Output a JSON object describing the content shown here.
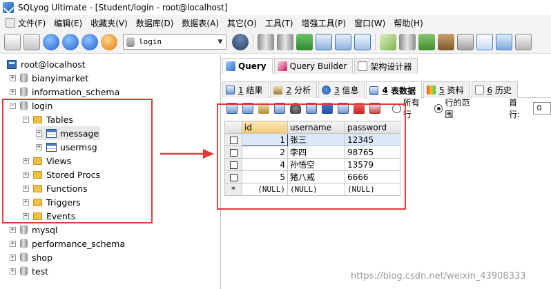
{
  "app": {
    "title": "SQLyog Ultimate - [Student/login - root@localhost]"
  },
  "menu": [
    "文件(F)",
    "编辑(E)",
    "收藏夹(V)",
    "数据库(D)",
    "数据表(A)",
    "其它(O)",
    "工具(T)",
    "增强工具(P)",
    "窗口(W)",
    "帮助(H)"
  ],
  "toolbar": {
    "db_selected": "login"
  },
  "tree": {
    "connection": "root@localhost",
    "databases": [
      "bianyimarket",
      "information_schema",
      "login",
      "mysql",
      "performance_schema",
      "shop",
      "test"
    ],
    "login_children": [
      "Tables",
      "Views",
      "Stored Procs",
      "Functions",
      "Triggers",
      "Events"
    ],
    "tables": [
      "message",
      "usermsg"
    ]
  },
  "top_tabs": [
    "Query",
    "Query Builder",
    "架构设计器"
  ],
  "bottom_tabs": [
    {
      "num": "1",
      "label": "结果"
    },
    {
      "num": "2",
      "label": "分析"
    },
    {
      "num": "3",
      "label": "信息"
    },
    {
      "num": "4",
      "label": "表数据"
    },
    {
      "num": "5",
      "label": "资料"
    },
    {
      "num": "6",
      "label": "历史"
    }
  ],
  "grid_options": {
    "all_rows": "所有行",
    "row_range": "行的范围",
    "first_row_label": "首行:",
    "first_row_value": "0"
  },
  "table": {
    "columns": [
      "id",
      "username",
      "password"
    ],
    "rows": [
      [
        "1",
        "张三",
        "12345"
      ],
      [
        "2",
        "李四",
        "98765"
      ],
      [
        "4",
        "孙悟空",
        "13579"
      ],
      [
        "5",
        "猪八戒",
        "6666"
      ],
      [
        "(NULL)",
        "(NULL)",
        "(NULL)"
      ]
    ],
    "new_row_marker": "*"
  },
  "watermark": "https://blog.csdn.net/weixin_43908333",
  "colors": {
    "annotation": "#e03a3a",
    "toolbar_bg": "#f3f3f3",
    "sorted_header": "#f2c86d"
  }
}
